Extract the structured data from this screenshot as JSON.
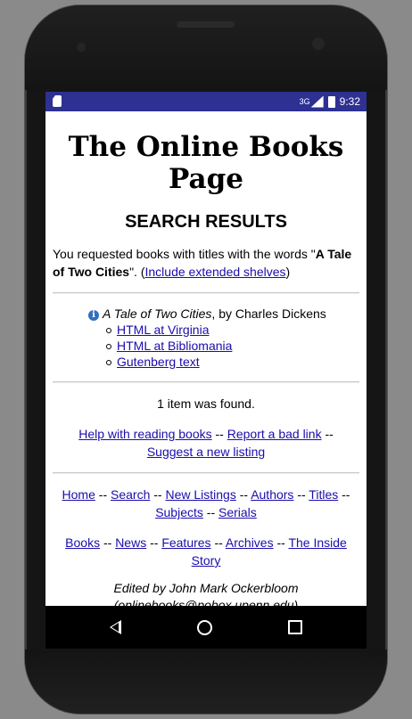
{
  "status_bar": {
    "network": "3G",
    "time": "9:32"
  },
  "page": {
    "site_title": "The Online Books Page",
    "heading": "SEARCH RESULTS",
    "request_prefix": "You requested books with titles with the words \"",
    "request_query": "A Tale of Two Cities",
    "request_suffix": "\". (",
    "extended_link": "Include extended shelves",
    "request_close": ")"
  },
  "result": {
    "title": "A Tale of Two Cities",
    "author_text": ", by Charles Dickens",
    "links": [
      "HTML at Virginia",
      "HTML at Bibliomania",
      "Gutenberg text"
    ]
  },
  "summary": {
    "count_text": "1 item was found."
  },
  "help_links": {
    "reading": "Help with reading books",
    "sep1": " -- ",
    "bad_link": "Report a bad link",
    "sep2": " -- ",
    "suggest": "Suggest a new listing"
  },
  "nav_row1": [
    "Home",
    "Search",
    "New Listings",
    "Authors",
    "Titles",
    "Subjects",
    "Serials"
  ],
  "nav_row2": [
    "Books",
    "News",
    "Features",
    "Archives",
    "The Inside Story"
  ],
  "footer": {
    "editor": "Edited by John Mark Ockerbloom",
    "email": "(onlinebooks@pobox.upenn.edu)"
  },
  "icons": [
    "sim-card-icon",
    "signal-icon",
    "battery-icon",
    "info-icon",
    "back-icon",
    "home-icon",
    "recents-icon"
  ],
  "colors": {
    "status_bar": "#2e3192",
    "link": "#1a0dab",
    "info_icon": "#2f6fc0"
  }
}
